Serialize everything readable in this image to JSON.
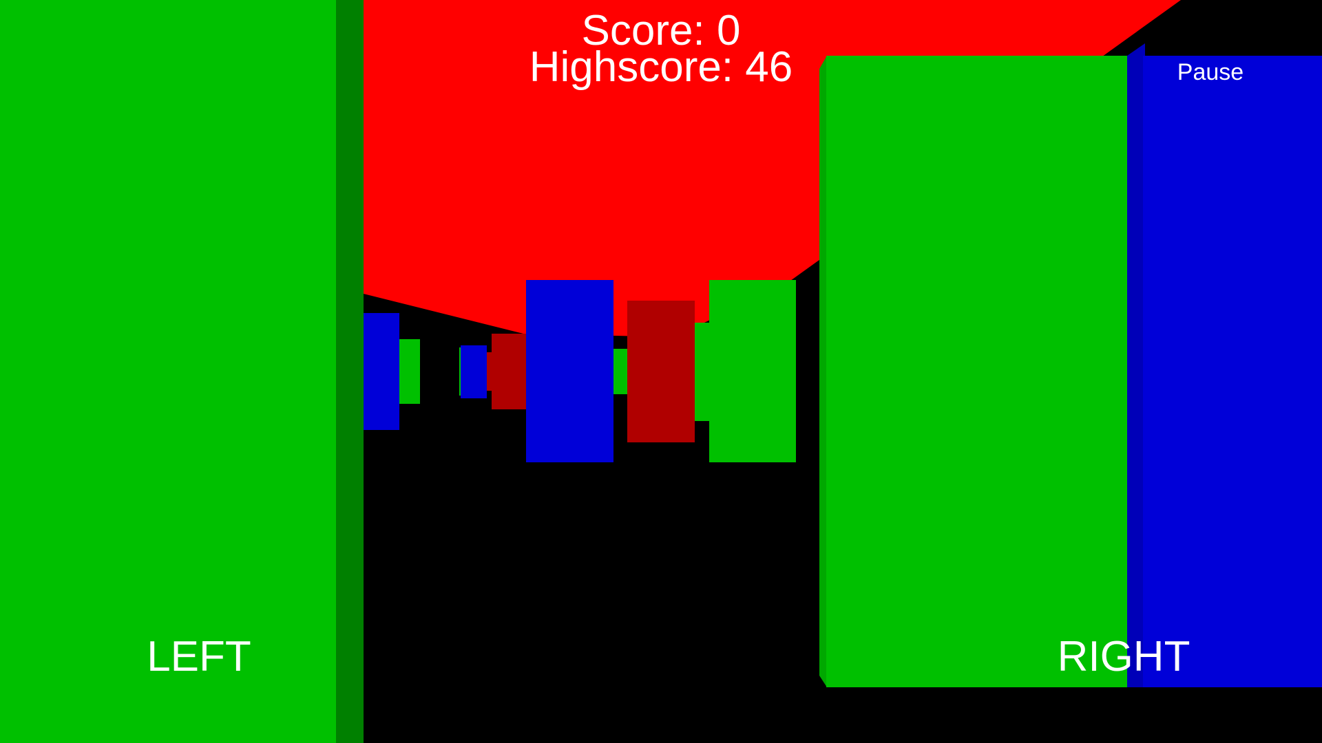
{
  "hud": {
    "score_text": "Score: 0",
    "highscore_text": "Highscore: 46",
    "pause_label": "Pause"
  },
  "controls": {
    "left_label": "LEFT",
    "right_label": "RIGHT"
  },
  "colors": {
    "background": "#000000",
    "ceiling": "#ff0000",
    "green": "#00c000",
    "green_side": "#008000",
    "blue": "#0000d8",
    "red_block": "#b00000",
    "text": "#ffffff"
  }
}
